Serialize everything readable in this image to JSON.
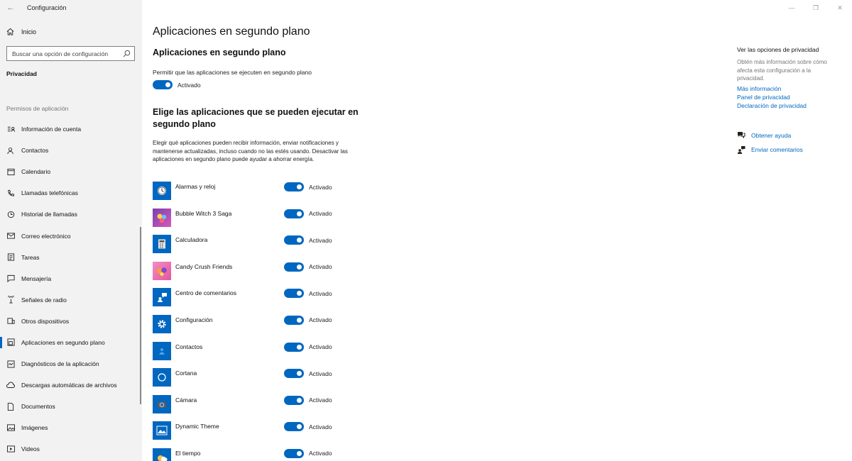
{
  "window": {
    "title": "Configuración",
    "back_icon": "←",
    "minimize": "—",
    "maximize": "❐",
    "close": "✕"
  },
  "sidebar": {
    "home_label": "Inicio",
    "search_placeholder": "Buscar una opción de configuración",
    "section_title": "Privacidad",
    "group_title": "Permisos de aplicación",
    "items": [
      {
        "label": "Información de cuenta",
        "icon": "account-info-icon"
      },
      {
        "label": "Contactos",
        "icon": "contacts-icon"
      },
      {
        "label": "Calendario",
        "icon": "calendar-icon"
      },
      {
        "label": "Llamadas telefónicas",
        "icon": "phone-icon"
      },
      {
        "label": "Historial de llamadas",
        "icon": "history-icon"
      },
      {
        "label": "Correo electrónico",
        "icon": "mail-icon"
      },
      {
        "label": "Tareas",
        "icon": "tasks-icon"
      },
      {
        "label": "Mensajería",
        "icon": "messaging-icon"
      },
      {
        "label": "Señales de radio",
        "icon": "radio-icon"
      },
      {
        "label": "Otros dispositivos",
        "icon": "devices-icon"
      },
      {
        "label": "Aplicaciones en segundo plano",
        "icon": "background-apps-icon"
      },
      {
        "label": "Diagnósticos de la aplicación",
        "icon": "diagnostics-icon"
      },
      {
        "label": "Descargas automáticas de archivos",
        "icon": "cloud-download-icon"
      },
      {
        "label": "Documentos",
        "icon": "documents-icon"
      },
      {
        "label": "Imágenes",
        "icon": "images-icon"
      },
      {
        "label": "Videos",
        "icon": "videos-icon"
      }
    ]
  },
  "main": {
    "page_title": "Aplicaciones en segundo plano",
    "sub_title": "Aplicaciones en segundo plano",
    "allow_label": "Permitir que las aplicaciones se ejecuten en segundo plano",
    "allow_state": "Activado",
    "choose_title": "Elige las aplicaciones que se pueden ejecutar en segundo plano",
    "description": "Elegir qué aplicaciones pueden recibir información, enviar notificaciones y mantenerse actualizadas, incluso cuando no las estés usando. Desactivar las aplicaciones en segundo plano puede ayudar a ahorrar energía.",
    "apps": [
      {
        "name": "Alarmas y reloj",
        "state": "Activado",
        "icon": "alarm-clock-icon",
        "color": "#0067c0"
      },
      {
        "name": "Bubble Witch 3 Saga",
        "state": "Activado",
        "icon": "bubble-witch-icon",
        "color": "#7a3fb0"
      },
      {
        "name": "Calculadora",
        "state": "Activado",
        "icon": "calculator-icon",
        "color": "#0067c0"
      },
      {
        "name": "Candy Crush Friends",
        "state": "Activado",
        "icon": "candy-crush-icon",
        "color": "#e5559d"
      },
      {
        "name": "Centro de comentarios",
        "state": "Activado",
        "icon": "feedback-hub-icon",
        "color": "#0067c0"
      },
      {
        "name": "Configuración",
        "state": "Activado",
        "icon": "settings-gear-icon",
        "color": "#0067c0"
      },
      {
        "name": "Contactos",
        "state": "Activado",
        "icon": "people-icon",
        "color": "#0067c0"
      },
      {
        "name": "Cortana",
        "state": "Activado",
        "icon": "cortana-icon",
        "color": "#0067c0"
      },
      {
        "name": "Cámara",
        "state": "Activado",
        "icon": "camera-icon",
        "color": "#0067c0"
      },
      {
        "name": "Dynamic Theme",
        "state": "Activado",
        "icon": "dynamic-theme-icon",
        "color": "#0067c0"
      },
      {
        "name": "El tiempo",
        "state": "Activado",
        "icon": "weather-icon",
        "color": "#0067c0"
      }
    ]
  },
  "right_panel": {
    "heading": "Ver las opciones de privacidad",
    "description": "Obtén más información sobre cómo afecta esta configuración a la privacidad.",
    "links": [
      "Más información",
      "Panel de privacidad",
      "Declaración de privacidad"
    ],
    "help_label": "Obtener ayuda",
    "feedback_label": "Enviar comentarios"
  },
  "colors": {
    "accent": "#0067c0",
    "sidebar_bg": "#f2f2f2"
  }
}
